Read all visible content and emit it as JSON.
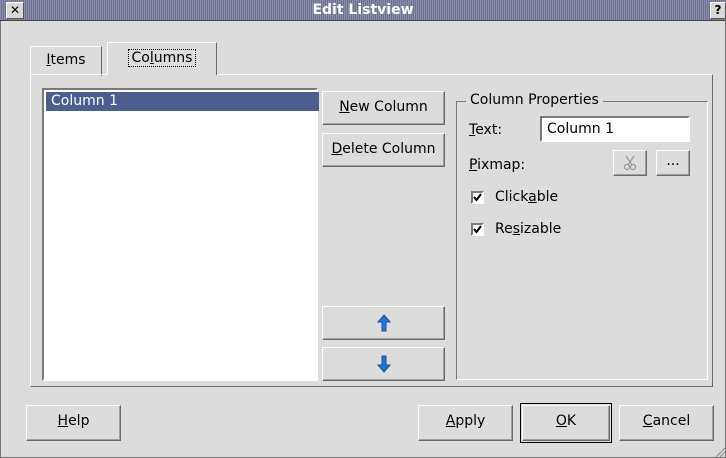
{
  "window": {
    "title": "Edit Listview",
    "close_glyph": "✕",
    "help_glyph": "?"
  },
  "tabs": [
    {
      "label_pre": "",
      "mnemonic": "I",
      "label_post": "tems",
      "active": false
    },
    {
      "label_pre": "Co",
      "mnemonic": "l",
      "label_post": "umns",
      "active": true
    }
  ],
  "column_list": {
    "items": [
      "Column 1"
    ],
    "selected_index": 0
  },
  "buttons": {
    "new_column": {
      "pre": "",
      "mnemonic": "N",
      "post": "ew Column"
    },
    "delete_column": {
      "pre": "",
      "mnemonic": "D",
      "post": "elete Column"
    },
    "move_up_icon": "arrow-up-icon",
    "move_down_icon": "arrow-down-icon"
  },
  "properties": {
    "group_title": "Column Properties",
    "text_label": {
      "pre": "",
      "mnemonic": "T",
      "post": "ext:"
    },
    "text_value": "Column 1",
    "pixmap_label": {
      "pre": "",
      "mnemonic": "P",
      "post": "ixmap:"
    },
    "pixmap_browse": "...",
    "clickable": {
      "pre": "Click",
      "mnemonic": "a",
      "post": "ble",
      "checked": true
    },
    "resizable": {
      "pre": "Re",
      "mnemonic": "s",
      "post": "izable",
      "checked": true
    }
  },
  "footer": {
    "help": {
      "pre": "",
      "mnemonic": "H",
      "post": "elp"
    },
    "apply": {
      "pre": "",
      "mnemonic": "A",
      "post": "pply"
    },
    "ok": {
      "pre": "",
      "mnemonic": "O",
      "post": "K"
    },
    "cancel": {
      "pre": "",
      "mnemonic": "C",
      "post": "ancel"
    }
  },
  "colors": {
    "selection": "#4b5e8d",
    "arrow": "#2a6fd6",
    "title_bar": "#7b809c"
  }
}
